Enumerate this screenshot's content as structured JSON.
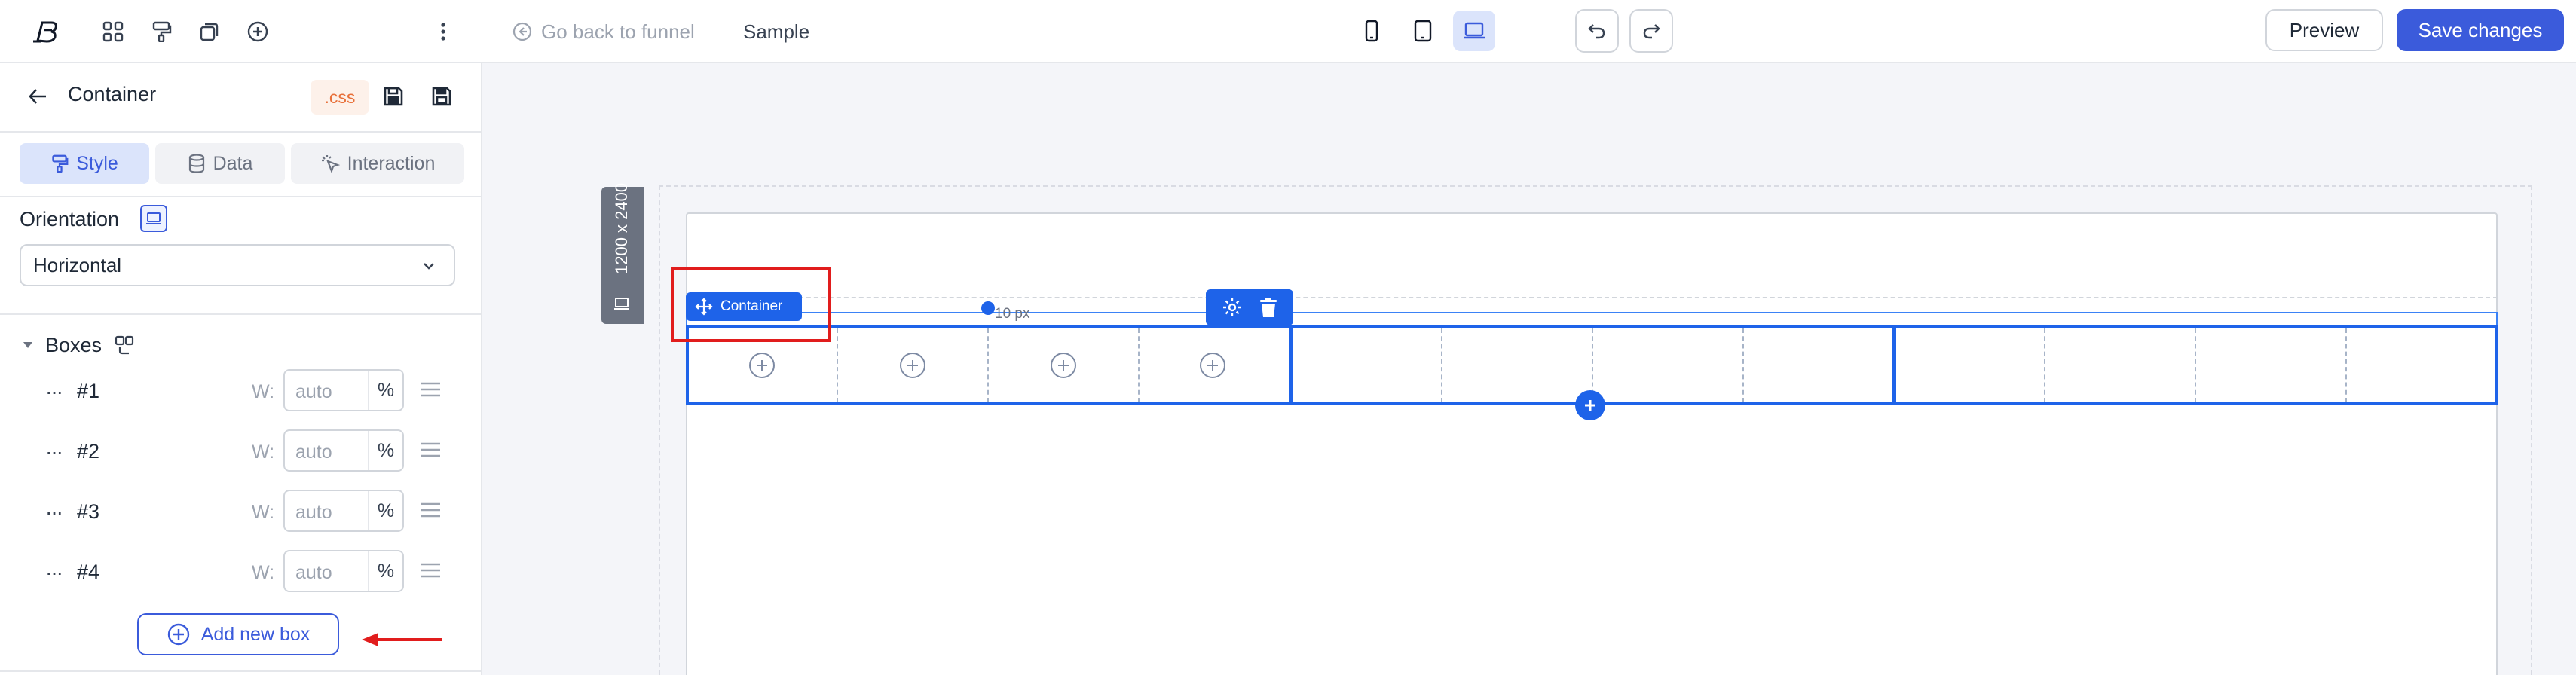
{
  "topbar": {
    "back_label": "Go back to funnel",
    "page_name": "Sample",
    "preview_label": "Preview",
    "save_label": "Save changes",
    "icons": [
      "logo-icon",
      "grid-icon",
      "paint-roller-icon",
      "layers-icon",
      "add-circle-icon",
      "more-vertical-icon",
      "mobile-icon",
      "tablet-icon",
      "desktop-icon",
      "undo-icon",
      "redo-icon"
    ],
    "active_device": "desktop"
  },
  "panel": {
    "title": "Container",
    "css_badge": ".css",
    "tabs": [
      {
        "label": "Style",
        "icon": "paint-roller-icon",
        "active": true
      },
      {
        "label": "Data",
        "icon": "database-icon",
        "active": false
      },
      {
        "label": "Interaction",
        "icon": "pointer-click-icon",
        "active": false
      }
    ],
    "orientation_label": "Orientation",
    "orientation_value": "Horizontal",
    "boxes_label": "Boxes",
    "boxes": [
      {
        "label": "#1",
        "w_label": "W:",
        "placeholder": "auto",
        "unit": "%"
      },
      {
        "label": "#2",
        "w_label": "W:",
        "placeholder": "auto",
        "unit": "%"
      },
      {
        "label": "#3",
        "w_label": "W:",
        "placeholder": "auto",
        "unit": "%"
      },
      {
        "label": "#4",
        "w_label": "W:",
        "placeholder": "auto",
        "unit": "%"
      }
    ],
    "add_box_label": "Add new box"
  },
  "canvas": {
    "dimensions": "1200 x 2400",
    "container_tag": "Container",
    "gap_label": "10 px"
  },
  "colors": {
    "accent": "#3b5bdb",
    "selection": "#1e63e9",
    "highlight": "#e11d1d"
  }
}
